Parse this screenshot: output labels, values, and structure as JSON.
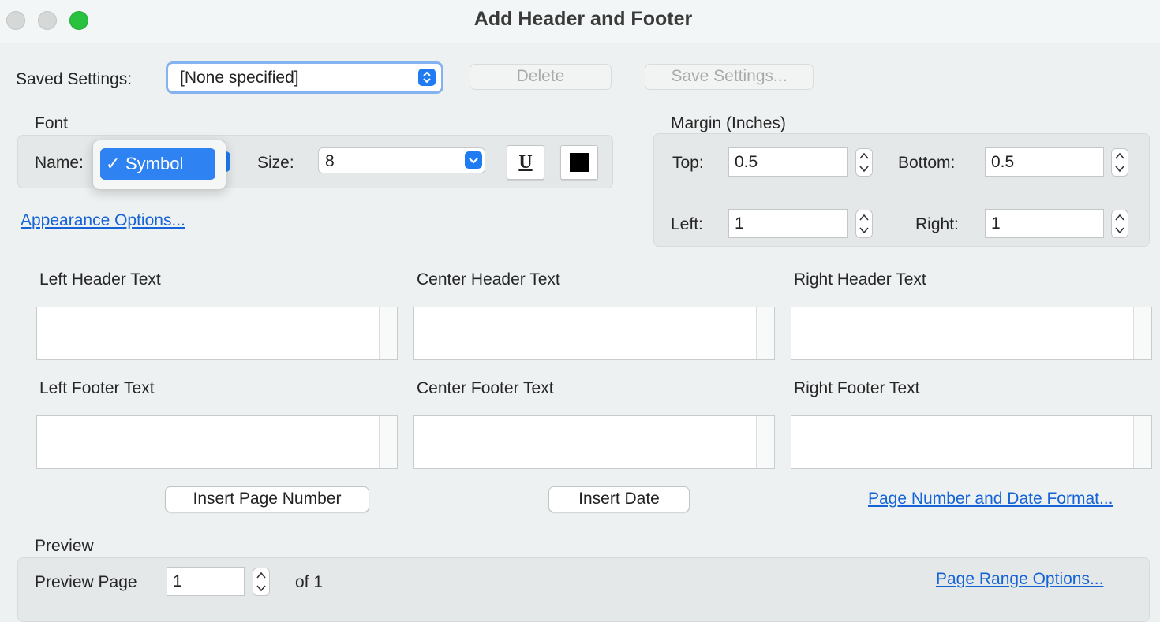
{
  "window": {
    "title": "Add Header and Footer"
  },
  "saved_settings": {
    "label": "Saved Settings:",
    "value": "[None specified]",
    "delete_label": "Delete",
    "save_label": "Save Settings..."
  },
  "font": {
    "group_label": "Font",
    "name_label": "Name:",
    "name_popup_item": "Symbol",
    "check_glyph": "✓",
    "size_label": "Size:",
    "size_value": "8",
    "underline_glyph": "U",
    "appearance_link": "Appearance Options..."
  },
  "margin": {
    "group_label": "Margin (Inches)",
    "top_label": "Top:",
    "top_value": "0.5",
    "bottom_label": "Bottom:",
    "bottom_value": "0.5",
    "left_label": "Left:",
    "left_value": "1",
    "right_label": "Right:",
    "right_value": "1"
  },
  "texts": {
    "left_header": "Left Header Text",
    "center_header": "Center Header Text",
    "right_header": "Right Header Text",
    "left_footer": "Left Footer Text",
    "center_footer": "Center Footer Text",
    "right_footer": "Right Footer Text"
  },
  "actions": {
    "insert_page_number": "Insert Page Number",
    "insert_date": "Insert Date",
    "format_link": "Page Number and Date Format..."
  },
  "preview": {
    "group_label": "Preview",
    "page_label": "Preview Page",
    "page_value": "1",
    "of_label": "of 1",
    "range_link": "Page Range Options..."
  },
  "colors": {
    "accent": "#1f7bf2",
    "link": "#1563d6",
    "font_color_swatch": "#000000"
  }
}
